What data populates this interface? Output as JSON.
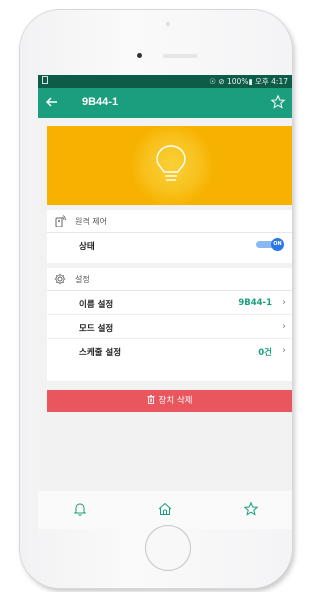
{
  "status_bar": {
    "text": "☉ ⊘ 100%▮ 오후 4:17"
  },
  "app_bar": {
    "title": "9B44-1",
    "back_icon": "arrow-left-icon",
    "favorite_icon": "star-outline-icon"
  },
  "hero": {
    "icon": "lightbulb-icon",
    "background_color": "#f7b200"
  },
  "remote_section": {
    "header": "원격 제어",
    "rows": [
      {
        "label": "상태",
        "toggle_text": "ON",
        "toggle_state": true
      }
    ]
  },
  "settings_section": {
    "header": "설정",
    "rows": [
      {
        "label": "이름 설정",
        "value": "9B44-1"
      },
      {
        "label": "모드 설정",
        "value": ""
      },
      {
        "label": "스케줄 설정",
        "value": "0건"
      }
    ]
  },
  "delete_button": {
    "label": "장치 삭제"
  },
  "bottom_nav": {
    "items": [
      "bell-icon",
      "home-icon",
      "star-icon"
    ]
  },
  "colors": {
    "primary": "#1a9e7d",
    "status_bar": "#0d5c48",
    "delete": "#e9565e",
    "toggle": "#2a78e6"
  }
}
